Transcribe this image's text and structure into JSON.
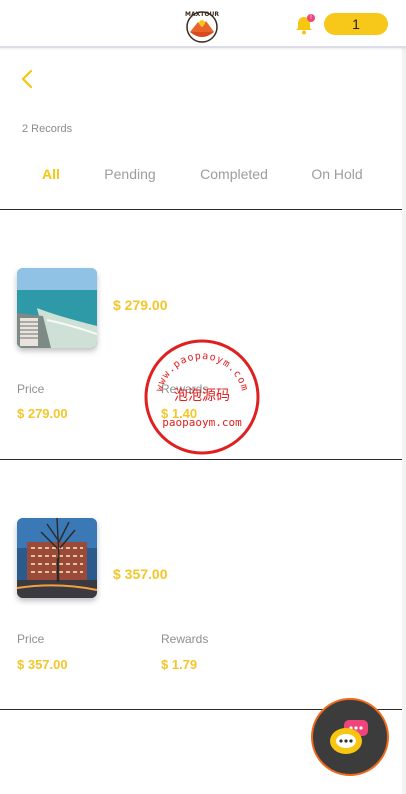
{
  "header": {
    "logo_text": "MAXTOUR",
    "notification_count": "!",
    "points": "1"
  },
  "records_label": "2 Records",
  "tabs": [
    {
      "label": "All",
      "active": true
    },
    {
      "label": "Pending",
      "active": false
    },
    {
      "label": "Completed",
      "active": false
    },
    {
      "label": "On Hold",
      "active": false
    }
  ],
  "orders": [
    {
      "image": "beach-hotel-photo",
      "total": "$ 279.00",
      "price_label": "Price",
      "price_value": "$ 279.00",
      "rewards_label": "Rewards",
      "rewards_value": "$ 1.40"
    },
    {
      "image": "city-building-photo",
      "total": "$ 357.00",
      "price_label": "Price",
      "price_value": "$ 357.00",
      "rewards_label": "Rewards",
      "rewards_value": "$ 1.79"
    }
  ],
  "watermark": {
    "top_text": "www.paopaoym.com",
    "center_text": "泡泡源码",
    "bottom_text": "paopaoym.com"
  },
  "colors": {
    "accent": "#f6c610",
    "price": "#f3c62b",
    "chat_border": "#f06a1a",
    "badge": "#f0457a",
    "watermark": "#e02020"
  }
}
